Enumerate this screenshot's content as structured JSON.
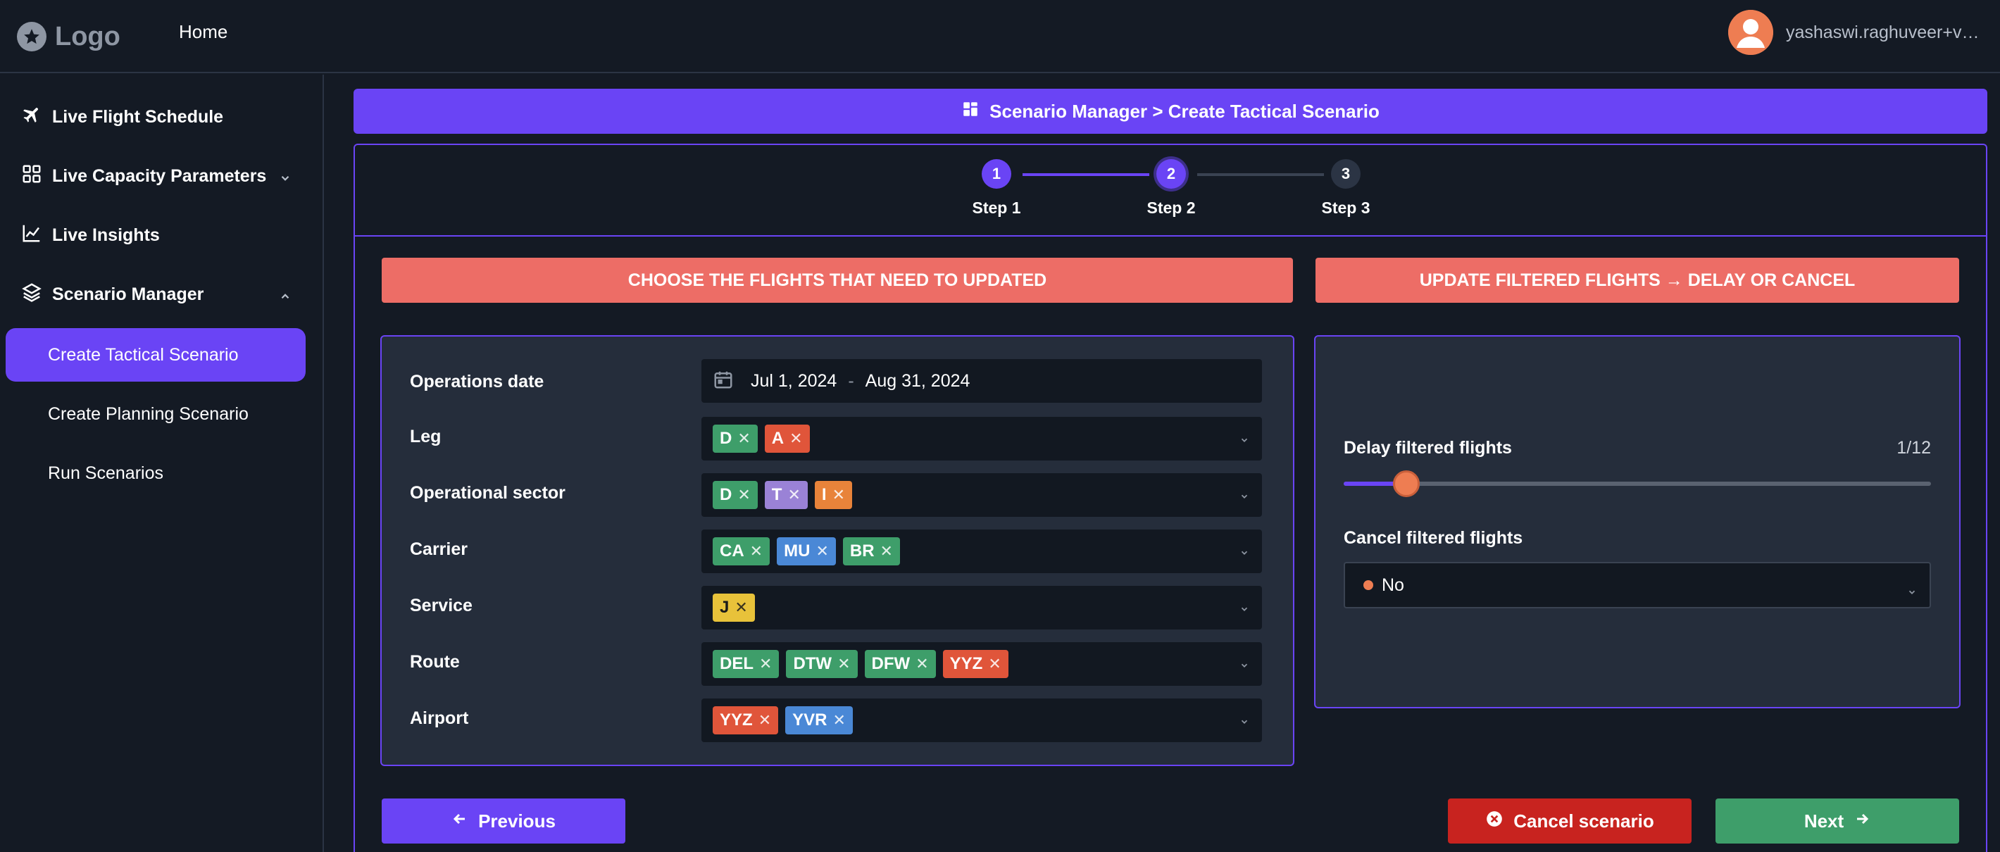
{
  "topbar": {
    "logo_text": "Logo",
    "home_label": "Home",
    "user_email": "yashaswi.raghuveer+vallani@..."
  },
  "sidebar": {
    "items": [
      {
        "label": "Live Flight Schedule",
        "icon": "airplane-icon"
      },
      {
        "label": "Live Capacity Parameters",
        "icon": "grid-icon",
        "expandable": true
      },
      {
        "label": "Live Insights",
        "icon": "chart-line-icon"
      },
      {
        "label": "Scenario Manager",
        "icon": "layers-icon",
        "expanded": true
      }
    ],
    "sub_items": [
      {
        "label": "Create Tactical Scenario",
        "active": true
      },
      {
        "label": "Create Planning Scenario",
        "active": false
      },
      {
        "label": "Run Scenarios",
        "active": false
      }
    ]
  },
  "breadcrumb": {
    "text": "Scenario Manager > Create Tactical Scenario",
    "icon": "dashboard-icon"
  },
  "stepper": {
    "steps": [
      {
        "number": "1",
        "label": "Step 1",
        "state": "completed"
      },
      {
        "number": "2",
        "label": "Step 2",
        "state": "active"
      },
      {
        "number": "3",
        "label": "Step 3",
        "state": "pending"
      }
    ]
  },
  "left_section": {
    "header": "CHOOSE THE FLIGHTS THAT NEED TO UPDATED",
    "fields": {
      "operations_date": {
        "label": "Operations date",
        "start": "Jul 1, 2024",
        "separator": "-",
        "end": "Aug 31, 2024"
      },
      "leg": {
        "label": "Leg",
        "tags": [
          {
            "text": "D",
            "color": "#3e9e6a"
          },
          {
            "text": "A",
            "color": "#e0553a"
          }
        ]
      },
      "operational_sector": {
        "label": "Operational sector",
        "tags": [
          {
            "text": "D",
            "color": "#3e9e6a"
          },
          {
            "text": "T",
            "color": "#9a82d6"
          },
          {
            "text": "I",
            "color": "#e8833a"
          }
        ]
      },
      "carrier": {
        "label": "Carrier",
        "tags": [
          {
            "text": "CA",
            "color": "#3e9e6a"
          },
          {
            "text": "MU",
            "color": "#4a88d6"
          },
          {
            "text": "BR",
            "color": "#3e9e6a"
          }
        ]
      },
      "service": {
        "label": "Service",
        "tags": [
          {
            "text": "J",
            "color": "#e8c23a",
            "textColor": "#1a1a1a"
          }
        ]
      },
      "route": {
        "label": "Route",
        "tags": [
          {
            "text": "DEL",
            "color": "#3e9e6a"
          },
          {
            "text": "DTW",
            "color": "#3e9e6a"
          },
          {
            "text": "DFW",
            "color": "#3e9e6a"
          },
          {
            "text": "YYZ",
            "color": "#e0553a"
          }
        ]
      },
      "airport": {
        "label": "Airport",
        "tags": [
          {
            "text": "YYZ",
            "color": "#e0553a"
          },
          {
            "text": "YVR",
            "color": "#4a88d6"
          }
        ]
      }
    }
  },
  "right_section": {
    "header": "UPDATE FILTERED FLIGHTS → DELAY OR CANCEL",
    "delay": {
      "label": "Delay filtered flights",
      "value_text": "1/12",
      "value": 1,
      "max": 12
    },
    "cancel": {
      "label": "Cancel filtered flights",
      "selected": "No",
      "dot_color": "#ee7d52"
    }
  },
  "buttons": {
    "previous": "Previous",
    "cancel_scenario": "Cancel scenario",
    "next": "Next"
  },
  "colors": {
    "accent": "#6a44f5",
    "header_red": "#ed6d66",
    "cancel_red": "#c8231f",
    "next_green": "#3e9e6a"
  }
}
